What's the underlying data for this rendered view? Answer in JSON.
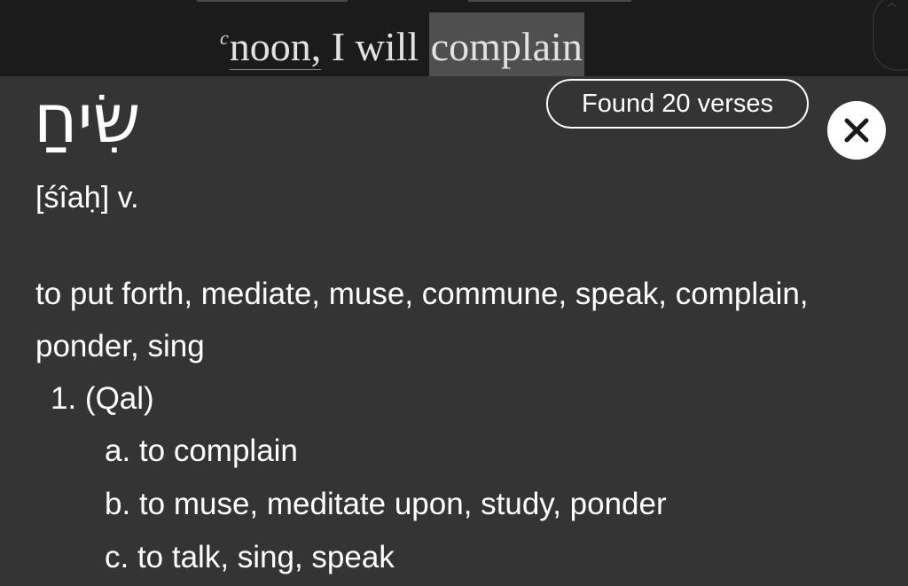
{
  "verse": {
    "superscript": "c",
    "word_noon": "noon,",
    "word_mid": " I will ",
    "highlighted_word": "complain"
  },
  "entry": {
    "hebrew": "שִׂיחַ",
    "transliteration": "[śîaḥ] v.",
    "definition": "to put forth, mediate, muse, commune, speak, complain, ponder, sing",
    "stem": "1. (Qal)",
    "senses": [
      "a. to complain",
      "b. to muse, meditate upon, study, ponder",
      "c. to talk, sing, speak"
    ]
  },
  "badge": {
    "found_label": "Found 20 verses"
  },
  "icons": {
    "close": "close-icon",
    "scroll_caret": "chevron-up-icon"
  },
  "colors": {
    "panel_background": "#343434",
    "strip_background": "#1b1b1b",
    "highlight": "#4f4f4f",
    "text": "#ffffff"
  }
}
